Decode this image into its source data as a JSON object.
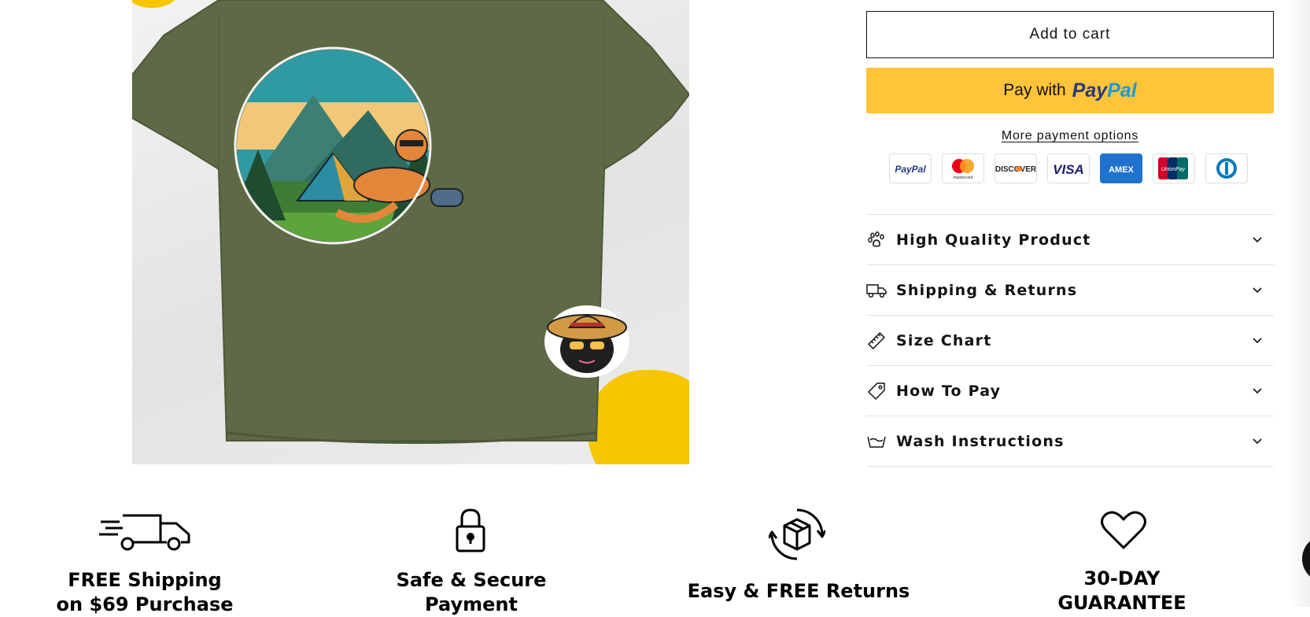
{
  "product_image": {
    "alt": "Olive green t-shirt with cat camping graphic"
  },
  "buy_buttons": {
    "add_to_cart": "Add to cart",
    "paypal_prefix": "Pay with",
    "paypal_brand_pay": "Pay",
    "paypal_brand_pal": "Pal",
    "more_payment_options": "More payment options"
  },
  "payment_icons": [
    {
      "name": "paypal",
      "label": "PayPal"
    },
    {
      "name": "mastercard",
      "label": "mastercard"
    },
    {
      "name": "discover",
      "label": "DISCOVER"
    },
    {
      "name": "visa",
      "label": "VISA"
    },
    {
      "name": "amex",
      "label": "AMEX"
    },
    {
      "name": "unionpay",
      "label": "UnionPay"
    },
    {
      "name": "diners-club",
      "label": ""
    }
  ],
  "accordion": [
    {
      "label": "High Quality Product",
      "icon": "paw-icon"
    },
    {
      "label": "Shipping & Returns",
      "icon": "truck-icon"
    },
    {
      "label": "Size Chart",
      "icon": "ruler-icon"
    },
    {
      "label": "How To Pay",
      "icon": "price-tag-icon"
    },
    {
      "label": "Wash Instructions",
      "icon": "wash-basin-icon"
    }
  ],
  "features": [
    {
      "line1": "FREE Shipping",
      "line2": "on $69 Purchase",
      "icon": "fast-truck-icon"
    },
    {
      "line1": "Safe & Secure",
      "line2": "Payment",
      "icon": "padlock-icon"
    },
    {
      "line1": "Easy & FREE Returns",
      "line2": "",
      "icon": "box-return-icon"
    },
    {
      "line1": "30-DAY",
      "line2": "GUARANTEE",
      "icon": "heart-icon"
    }
  ],
  "colors": {
    "paypal_yellow": "#ffc439",
    "paypal_dark_blue": "#253b80",
    "paypal_light_blue": "#179bd7",
    "accent_yellow": "#f7c600",
    "shirt_olive": "#5d6a45"
  }
}
